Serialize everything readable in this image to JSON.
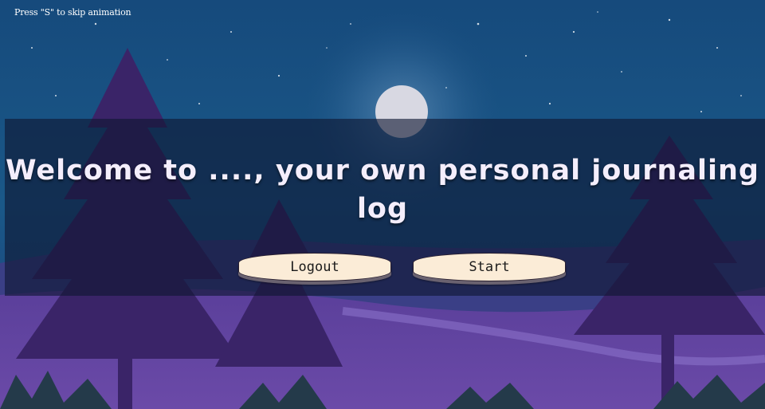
{
  "hint": "Press \"S\" to skip animation",
  "title": "Welcome to ...., your own personal journaling log",
  "buttons": {
    "logout": "Logout",
    "start": "Start"
  }
}
